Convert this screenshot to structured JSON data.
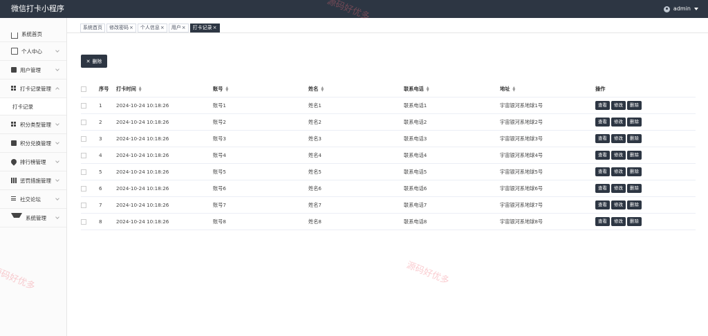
{
  "header": {
    "title": "微信打卡小程序",
    "user": "admin"
  },
  "sidebar": {
    "items": [
      {
        "label": "系统首页",
        "icon": "home-icon"
      },
      {
        "label": "个人中心",
        "icon": "card-icon"
      },
      {
        "label": "用户管理",
        "icon": "briefcase-icon"
      },
      {
        "label": "打卡记录管理",
        "icon": "grid-icon"
      },
      {
        "label": "积分类型管理",
        "icon": "grid-icon"
      },
      {
        "label": "积分兑换管理",
        "icon": "clipboard-icon"
      },
      {
        "label": "排行榜管理",
        "icon": "pin-icon"
      },
      {
        "label": "惩罚措施管理",
        "icon": "table-icon"
      },
      {
        "label": "社交论坛",
        "icon": "sliders-icon"
      },
      {
        "label": "系统管理",
        "icon": "funnel-icon"
      }
    ],
    "sub_item": "打卡记录"
  },
  "tabs": [
    "系统首页",
    "修改密码",
    "个人信息",
    "用户",
    "打卡记录"
  ],
  "toolbar": {
    "delete_label": "删除"
  },
  "table": {
    "headers": [
      "序号",
      "打卡时间",
      "账号",
      "姓名",
      "联系电话",
      "地址",
      "操作"
    ],
    "rows": [
      {
        "no": "1",
        "time": "2024-10-24 10:18:26",
        "account": "账号1",
        "name": "姓名1",
        "phone": "联系电话1",
        "addr": "宇宙银河系地球1号"
      },
      {
        "no": "2",
        "time": "2024-10-24 10:18:26",
        "account": "账号2",
        "name": "姓名2",
        "phone": "联系电话2",
        "addr": "宇宙银河系地球2号"
      },
      {
        "no": "3",
        "time": "2024-10-24 10:18:26",
        "account": "账号3",
        "name": "姓名3",
        "phone": "联系电话3",
        "addr": "宇宙银河系地球3号"
      },
      {
        "no": "4",
        "time": "2024-10-24 10:18:26",
        "account": "账号4",
        "name": "姓名4",
        "phone": "联系电话4",
        "addr": "宇宙银河系地球4号"
      },
      {
        "no": "5",
        "time": "2024-10-24 10:18:26",
        "account": "账号5",
        "name": "姓名5",
        "phone": "联系电话5",
        "addr": "宇宙银河系地球5号"
      },
      {
        "no": "6",
        "time": "2024-10-24 10:18:26",
        "account": "账号6",
        "name": "姓名6",
        "phone": "联系电话6",
        "addr": "宇宙银河系地球6号"
      },
      {
        "no": "7",
        "time": "2024-10-24 10:18:26",
        "account": "账号7",
        "name": "姓名7",
        "phone": "联系电话7",
        "addr": "宇宙银河系地球7号"
      },
      {
        "no": "8",
        "time": "2024-10-24 10:18:26",
        "account": "账号8",
        "name": "姓名8",
        "phone": "联系电话8",
        "addr": "宇宙银河系地球8号"
      }
    ],
    "actions": {
      "view": "查看",
      "edit": "修改",
      "delete": "删除"
    }
  },
  "watermark": "源码好优多",
  "colors": {
    "header_bg": "#2d3643",
    "button_bg": "#2d3643"
  }
}
